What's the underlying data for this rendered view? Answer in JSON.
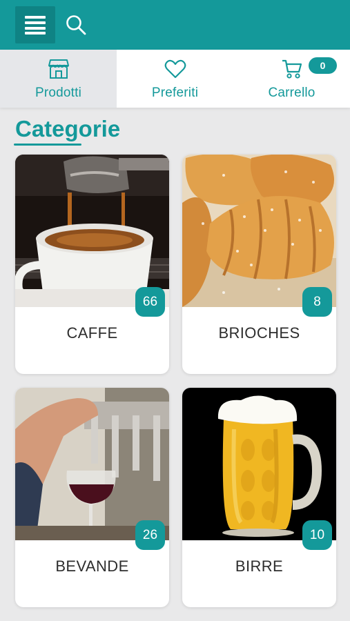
{
  "header": {
    "menu_icon": "hamburger-menu-icon",
    "search_icon": "search-icon",
    "colors": {
      "primary": "#14999a",
      "primary_dark": "#0f8384",
      "background": "#e9e9ea"
    }
  },
  "tabs": [
    {
      "label": "Prodotti",
      "icon": "store-icon",
      "active": true
    },
    {
      "label": "Preferiti",
      "icon": "heart-icon",
      "active": false
    },
    {
      "label": "Carrello",
      "icon": "cart-icon",
      "active": false,
      "badge": "0"
    }
  ],
  "section": {
    "title": "Categorie"
  },
  "categories": [
    {
      "name": "CAFFE",
      "count": "66",
      "image": "espresso-photo"
    },
    {
      "name": "BRIOCHES",
      "count": "8",
      "image": "croissant-photo"
    },
    {
      "name": "BEVANDE",
      "count": "26",
      "image": "wine-tap-photo"
    },
    {
      "name": "BIRRE",
      "count": "10",
      "image": "beer-mug-photo"
    }
  ]
}
